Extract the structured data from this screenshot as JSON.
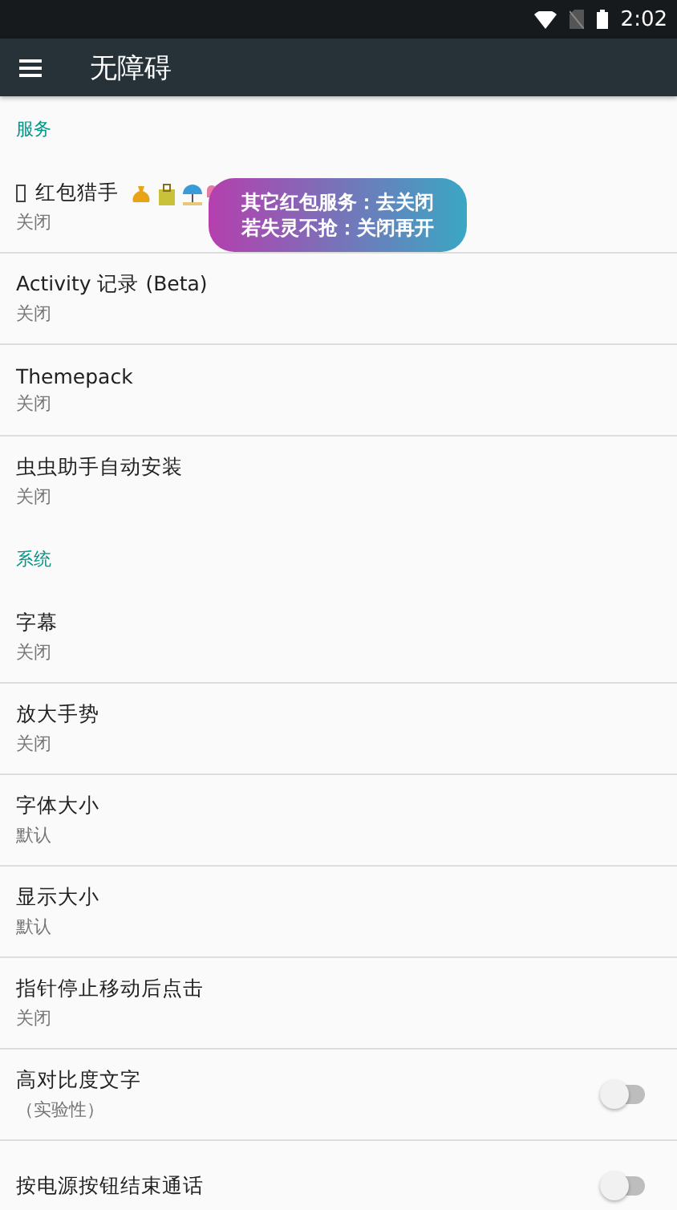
{
  "status_bar": {
    "time": "2:02"
  },
  "toolbar": {
    "title": "无障碍"
  },
  "sections": [
    {
      "header": "服务",
      "items": [
        {
          "kind": "text",
          "title": "红包猎手",
          "subtitle": "关闭",
          "emoji": true
        },
        {
          "kind": "text",
          "title": "Activity 记录 (Beta)",
          "subtitle": "关闭"
        },
        {
          "kind": "text",
          "title": "Themepack",
          "subtitle": "关闭"
        },
        {
          "kind": "text",
          "title": "虫虫助手自动安装",
          "subtitle": "关闭"
        }
      ]
    },
    {
      "header": "系统",
      "items": [
        {
          "kind": "text",
          "title": "字幕",
          "subtitle": "关闭"
        },
        {
          "kind": "text",
          "title": "放大手势",
          "subtitle": "关闭"
        },
        {
          "kind": "text",
          "title": "字体大小",
          "subtitle": "默认"
        },
        {
          "kind": "text",
          "title": "显示大小",
          "subtitle": "默认"
        },
        {
          "kind": "text",
          "title": "指针停止移动后点击",
          "subtitle": "关闭"
        },
        {
          "kind": "switch",
          "title": "高对比度文字",
          "subtitle": "（实验性）",
          "on": false
        },
        {
          "kind": "switch",
          "title": "按电源按钮结束通话",
          "on": false
        }
      ]
    }
  ],
  "bubble": {
    "lines": [
      "其它红包服务：去关闭",
      "若失灵不抢：关闭再开"
    ]
  }
}
